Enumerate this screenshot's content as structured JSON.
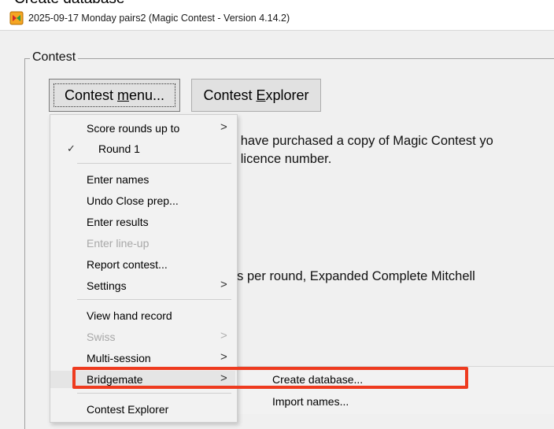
{
  "top_strip": {
    "text": "Create database"
  },
  "window": {
    "title": "2025-09-17  Monday pairs2  (Magic Contest - Version 4.14.2)"
  },
  "group": {
    "label": "Contest"
  },
  "buttons": {
    "contest_menu": {
      "prefix": "Contest ",
      "mnemonic": "m",
      "suffix": "enu..."
    },
    "contest_explorer": {
      "prefix": "Contest ",
      "mnemonic": "E",
      "suffix": "xplorer"
    }
  },
  "content": {
    "line1": "u have purchased a copy of Magic Contest yo",
    "line2": "d licence number.",
    "line3": "ds per round, Expanded Complete Mitchell"
  },
  "menu": {
    "score_rounds": "Score rounds up to",
    "round1_check": "✓",
    "round1": "Round 1",
    "enter_names": "Enter names",
    "undo_close": "Undo Close prep...",
    "enter_results": "Enter results",
    "enter_lineup": "Enter line-up",
    "report_contest": "Report contest...",
    "settings": "Settings",
    "view_hand": "View hand record",
    "swiss": "Swiss",
    "multi_session": "Multi-session",
    "bridgemate": "Bridgemate",
    "contest_explorer": "Contest Explorer",
    "arrow": ">"
  },
  "submenu": {
    "create_database": "Create database...",
    "import_names": "Import names..."
  },
  "colors": {
    "highlight_box": "#ee3b1f",
    "menu_bg": "#f2f2f2"
  }
}
